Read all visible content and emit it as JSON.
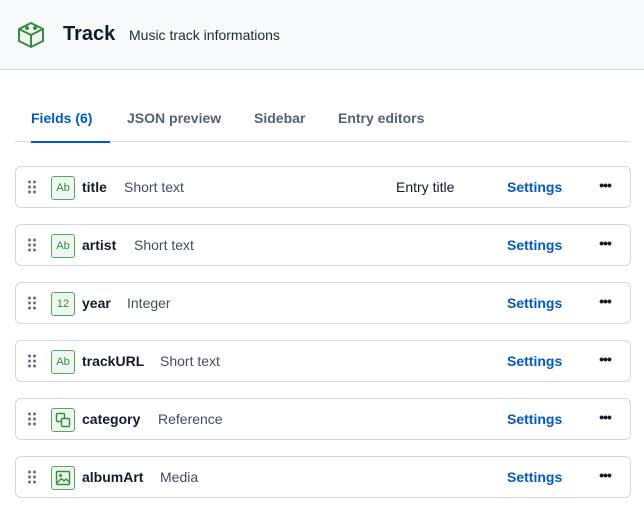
{
  "header": {
    "title": "Track",
    "description": "Music track informations",
    "icon": "content-type-icon"
  },
  "tabs": [
    {
      "label": "Fields (6)",
      "active": true
    },
    {
      "label": "JSON preview",
      "active": false
    },
    {
      "label": "Sidebar",
      "active": false
    },
    {
      "label": "Entry editors",
      "active": false
    }
  ],
  "fields": [
    {
      "name": "title",
      "type": "Short text",
      "badge": "Entry title",
      "icon": "text-icon",
      "icon_label": "Ab",
      "settings_label": "Settings"
    },
    {
      "name": "artist",
      "type": "Short text",
      "badge": "",
      "icon": "text-icon",
      "icon_label": "Ab",
      "settings_label": "Settings"
    },
    {
      "name": "year",
      "type": "Integer",
      "badge": "",
      "icon": "number-icon",
      "icon_label": "12",
      "settings_label": "Settings"
    },
    {
      "name": "trackURL",
      "type": "Short text",
      "badge": "",
      "icon": "text-icon",
      "icon_label": "Ab",
      "settings_label": "Settings"
    },
    {
      "name": "category",
      "type": "Reference",
      "badge": "",
      "icon": "reference-icon",
      "icon_label": "",
      "settings_label": "Settings"
    },
    {
      "name": "albumArt",
      "type": "Media",
      "badge": "",
      "icon": "media-icon",
      "icon_label": "",
      "settings_label": "Settings"
    }
  ],
  "more_label": "•••",
  "colors": {
    "accent": "#0059c8",
    "field_icon_border": "#5aa463",
    "header_bg": "#f7f9fa"
  }
}
